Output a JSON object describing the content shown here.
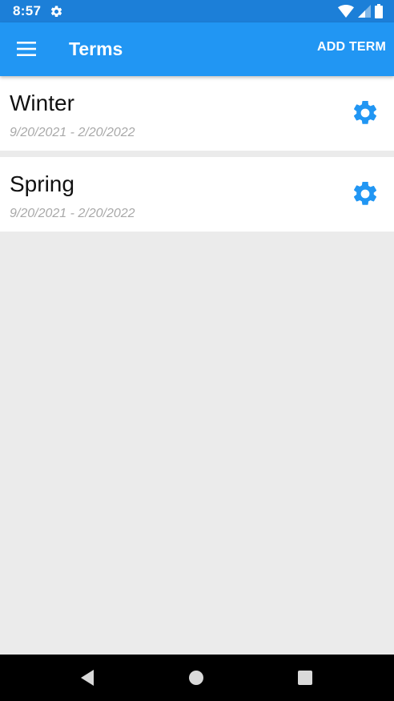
{
  "status_bar": {
    "time": "8:57",
    "icons": [
      "settings-gear-icon",
      "wifi-icon",
      "signal-icon",
      "battery-icon"
    ]
  },
  "app_bar": {
    "menu_icon": "hamburger-menu-icon",
    "title": "Terms",
    "action_label": "ADD TERM"
  },
  "terms": [
    {
      "name": "Winter",
      "dates": "9/20/2021 - 2/20/2022",
      "icon": "gear-icon"
    },
    {
      "name": "Spring",
      "dates": "9/20/2021 - 2/20/2022",
      "icon": "gear-icon"
    }
  ],
  "nav_bar": {
    "buttons": [
      "back-icon",
      "home-icon",
      "recents-icon"
    ]
  },
  "colors": {
    "status_bar": "#1c7fd8",
    "app_bar": "#2196f3",
    "accent": "#2196f3",
    "background": "#ebebeb",
    "date_text": "#a9a9a9"
  }
}
